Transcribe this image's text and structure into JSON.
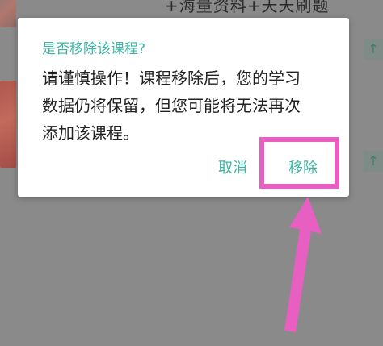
{
  "background": {
    "top_text": "+海量资料+天天刷题",
    "arrow_glyph": "↑"
  },
  "dialog": {
    "title": "是否移除该课程?",
    "message_lines": [
      "请谨慎操作！课程移除后，您的学习",
      "数据仍将保留，但您可能将无法再次",
      "添加该课程。"
    ],
    "cancel_label": "取消",
    "remove_label": "移除"
  },
  "annotation": {
    "highlight_color": "#e75fc1",
    "arrow_color": "#e75fc1"
  },
  "colors": {
    "accent": "#3cb4a4",
    "overlay": "#8a8a8a"
  }
}
